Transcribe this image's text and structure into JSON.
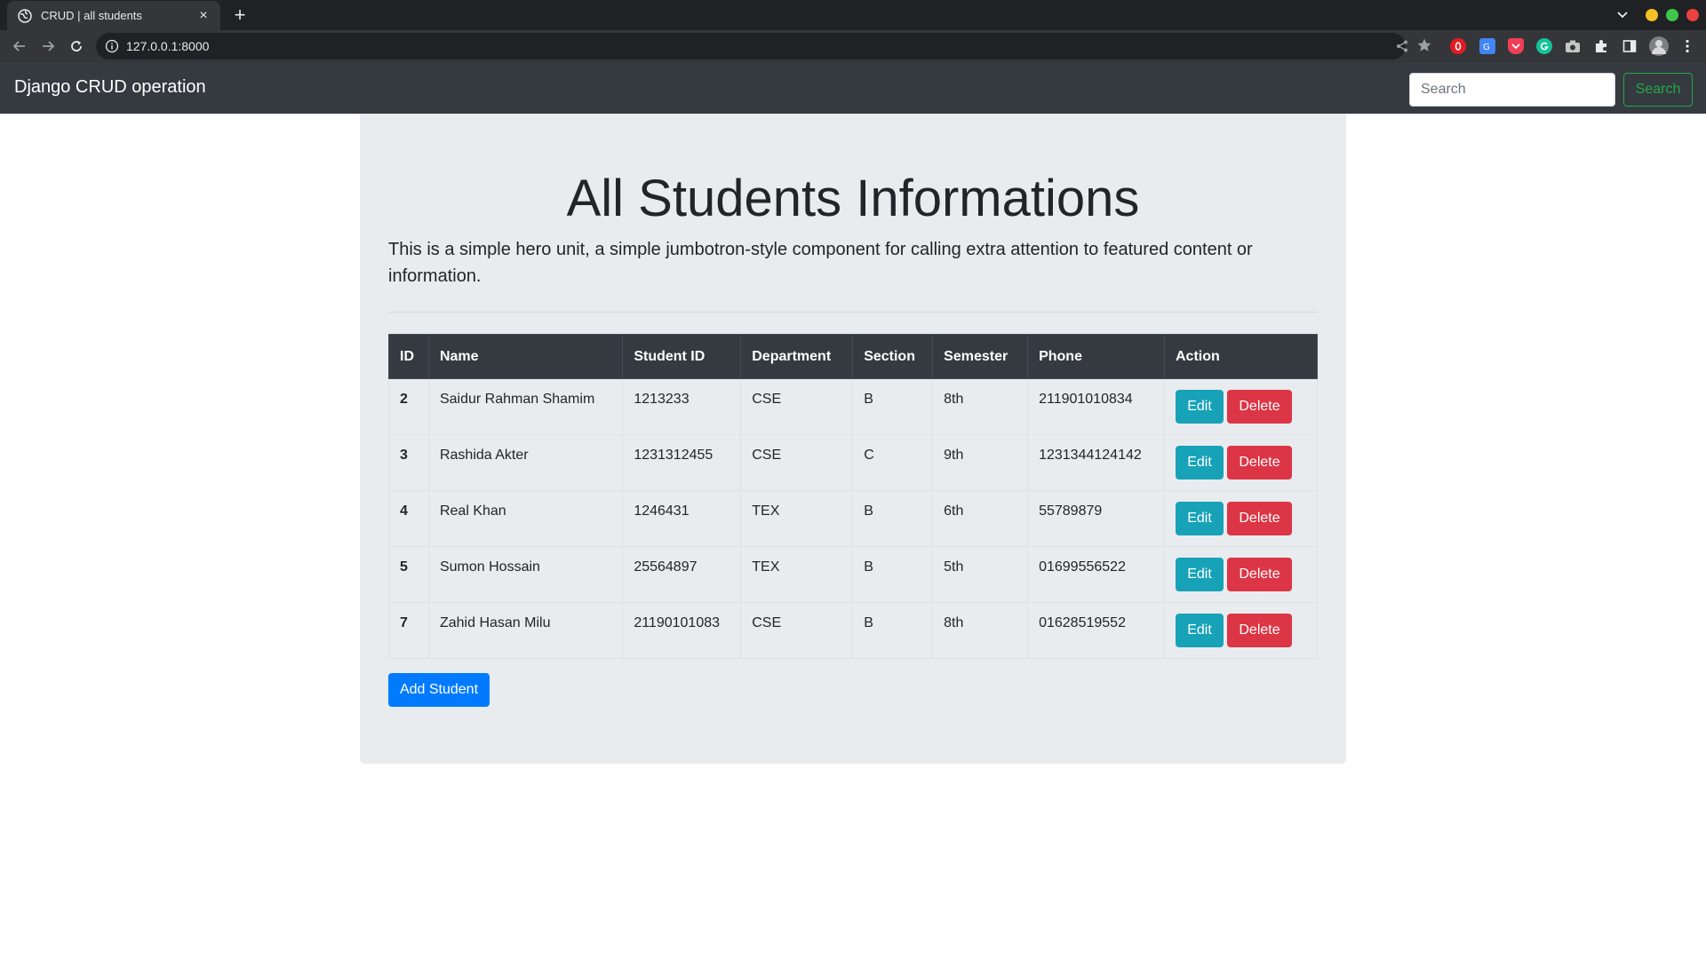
{
  "browser": {
    "tab_title": "CRUD | all students",
    "tab_close": "×",
    "new_tab": "+",
    "url": "127.0.0.1:8000",
    "icons": [
      "back-arrow-icon",
      "forward-arrow-icon",
      "reload-icon",
      "info-icon",
      "share-icon",
      "star-icon"
    ],
    "window_controls": {
      "minimize": "#f4c025",
      "maximize": "#3dc64a",
      "close": "#ec4141"
    }
  },
  "navbar": {
    "brand": "Django CRUD operation",
    "search_placeholder": "Search",
    "search_button": "Search",
    "colors": {
      "background": "#343a40",
      "search_button": "#28a745"
    }
  },
  "main": {
    "title": "All Students Informations",
    "lead": "This is a simple hero unit, a simple jumbotron-style component for calling extra attention to featured content or information."
  },
  "table": {
    "headers": [
      "ID",
      "Name",
      "Student ID",
      "Department",
      "Section",
      "Semester",
      "Phone",
      "Action"
    ],
    "edit_label": "Edit",
    "delete_label": "Delete",
    "rows": [
      {
        "id": "2",
        "name": "Saidur Rahman Shamim",
        "student_id": "1213233",
        "department": "CSE",
        "section": "B",
        "semester": "8th",
        "phone": "211901010834"
      },
      {
        "id": "3",
        "name": "Rashida Akter",
        "student_id": "1231312455",
        "department": "CSE",
        "section": "C",
        "semester": "9th",
        "phone": "1231344124142"
      },
      {
        "id": "4",
        "name": "Real Khan",
        "student_id": "1246431",
        "department": "TEX",
        "section": "B",
        "semester": "6th",
        "phone": "55789879"
      },
      {
        "id": "5",
        "name": "Sumon Hossain",
        "student_id": "25564897",
        "department": "TEX",
        "section": "B",
        "semester": "5th",
        "phone": "01699556522"
      },
      {
        "id": "7",
        "name": "Zahid Hasan Milu",
        "student_id": "21190101083",
        "department": "CSE",
        "section": "B",
        "semester": "8th",
        "phone": "01628519552"
      }
    ],
    "colors": {
      "header": "#343a40",
      "edit": "#17a2b8",
      "delete": "#dc3545"
    }
  },
  "add_button": "Add Student",
  "add_button_color": "#007bff"
}
